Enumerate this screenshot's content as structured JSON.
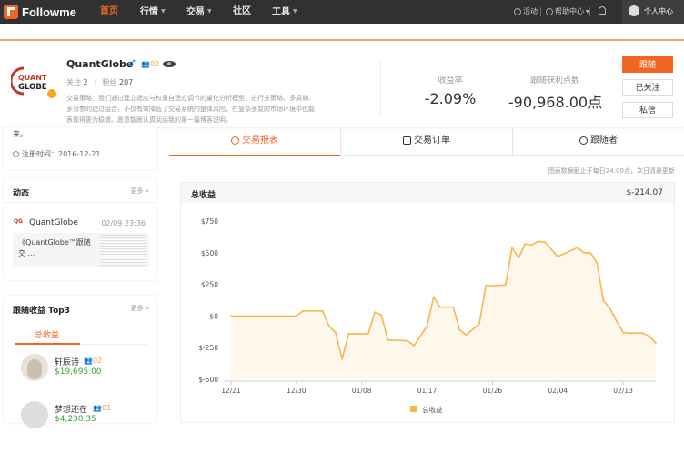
{
  "nav": {
    "logo_text": "Followme",
    "items": [
      {
        "label": "首页",
        "active": true
      },
      {
        "label": "行情",
        "has_caret": true
      },
      {
        "label": "交易",
        "has_caret": true
      },
      {
        "label": "社区"
      },
      {
        "label": "工具",
        "has_caret": true
      }
    ],
    "activity": "活动",
    "help": "帮助中心",
    "personal": "个人中心"
  },
  "profile": {
    "name": "QuantGlobe",
    "level": "02",
    "follow_label": "关注",
    "follow_count": "2",
    "fans_label": "粉丝",
    "fans_count": "207",
    "description": "交易策略：我们通过建立适应与权重自适应调节的量化分析模型，进行多策略、多周期、多对参的建过组合，不仅有效降低了交易系统的整体风险，在复杂多变的市场环境中也能表现得更为稳健。愿意能跟认真阅读我的第一篇博客说明。",
    "logo_lines": [
      "QUANT",
      "GLOBE"
    ],
    "return_label": "收益率",
    "return_value": "-2.09%",
    "pips_label": "跟随获利点数",
    "pips_value": "-90,968.00点",
    "btn_follow": "跟随",
    "btn_watched": "已关注",
    "btn_message": "私信"
  },
  "left": {
    "intro_tail": "来。",
    "register": "注册时间：2016-12-21",
    "feed_title": "动态",
    "more": "更多",
    "feed_user": "QuantGlobe",
    "feed_time": "02/09 23:36",
    "feed_text": "《QuantGlobe™跟随交 ...",
    "top3_title": "跟随收益 Top3",
    "top3_tab": "总收益",
    "top3": [
      {
        "name": "轩辰诗",
        "level": "02",
        "amount": "$19,695.00"
      },
      {
        "name": "梦想还在",
        "level": "01",
        "amount": "$4,230.35"
      }
    ]
  },
  "tabs": [
    "交易报表",
    "交易订单",
    "跟随者"
  ],
  "note": "图表数据截止于每日24:00点，次日清晨更新",
  "chart_header": {
    "title": "总收益",
    "total": "$-214.07"
  },
  "colors": {
    "accent": "#f26522",
    "line": "#f5b74a"
  },
  "chart_data": {
    "type": "area",
    "title": "总收益",
    "series": [
      {
        "name": "总收益"
      }
    ],
    "x_ticks": [
      "12/21",
      "12/30",
      "01/08",
      "01/17",
      "01/26",
      "02/04",
      "02/13"
    ],
    "y_ticks": [
      "$750",
      "$500",
      "$250",
      "$0",
      "$-250",
      "$-500"
    ],
    "ylim": [
      -500,
      750
    ],
    "points": [
      [
        0,
        0
      ],
      [
        5,
        0
      ],
      [
        10,
        0
      ],
      [
        11,
        40
      ],
      [
        14,
        40
      ],
      [
        15,
        -80
      ],
      [
        16,
        -130
      ],
      [
        17,
        -340
      ],
      [
        18,
        -140
      ],
      [
        21,
        -140
      ],
      [
        22,
        30
      ],
      [
        23,
        10
      ],
      [
        24,
        -190
      ],
      [
        27,
        -195
      ],
      [
        28,
        -235
      ],
      [
        30,
        -80
      ],
      [
        31,
        150
      ],
      [
        32,
        70
      ],
      [
        34,
        70
      ],
      [
        35,
        -110
      ],
      [
        36,
        -150
      ],
      [
        38,
        -60
      ],
      [
        39,
        240
      ],
      [
        40,
        240
      ],
      [
        42,
        245
      ],
      [
        43,
        540
      ],
      [
        44,
        460
      ],
      [
        45,
        570
      ],
      [
        46,
        560
      ],
      [
        47,
        590
      ],
      [
        48,
        585
      ],
      [
        50,
        470
      ],
      [
        53,
        540
      ],
      [
        54,
        500
      ],
      [
        55,
        500
      ],
      [
        56,
        420
      ],
      [
        57,
        120
      ],
      [
        58,
        60
      ],
      [
        59,
        -40
      ],
      [
        60,
        -130
      ],
      [
        61,
        -135
      ],
      [
        63,
        -135
      ],
      [
        64,
        -160
      ],
      [
        65,
        -215
      ]
    ],
    "x_domain": [
      0,
      65
    ],
    "tick_positions": [
      0,
      10,
      20,
      30,
      40,
      50,
      60
    ],
    "legend": "bottom",
    "grid": false
  }
}
